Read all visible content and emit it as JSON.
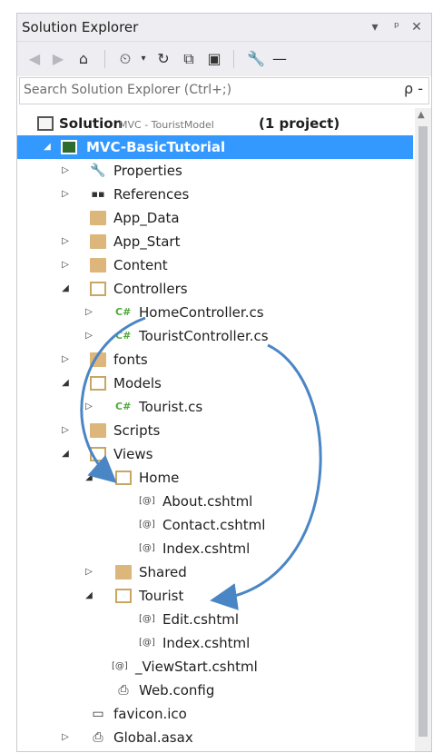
{
  "window": {
    "title": "Solution Explorer",
    "buttons": [
      "▾",
      "ᵖ",
      "✕"
    ]
  },
  "toolbar": {
    "icons": [
      "back-icon",
      "forward-icon",
      "home-icon",
      "history-icon",
      "refresh-icon",
      "collapse-all-icon",
      "show-all-files-icon",
      "properties-icon",
      "pin-icon"
    ]
  },
  "search": {
    "placeholder": "Search Solution Explorer (Ctrl+;)",
    "icon": "ρ -"
  },
  "tree": {
    "solution": {
      "label": "Solution",
      "name": "MVC - TouristModel",
      "suffix": "(1 project)"
    },
    "project": "MVC-BasicTutorial",
    "items": [
      "Properties",
      "References",
      "App_Data",
      "App_Start",
      "Content",
      "Controllers",
      "HomeController.cs",
      "TouristController.cs",
      "fonts",
      "Models",
      "Tourist.cs",
      "Scripts",
      "Views",
      "Home",
      "About.cshtml",
      "Contact.cshtml",
      "Index.cshtml",
      "Shared",
      "Tourist",
      "Edit.cshtml",
      "Index.cshtml",
      "_ViewStart.cshtml",
      "Web.config",
      "favicon.ico",
      "Global.asax"
    ],
    "cs_badge": "C#",
    "razor_badge": "[@]"
  },
  "colors": {
    "selection": "#3399ff",
    "folder": "#dcb67a",
    "arrow": "#4a86c5"
  }
}
